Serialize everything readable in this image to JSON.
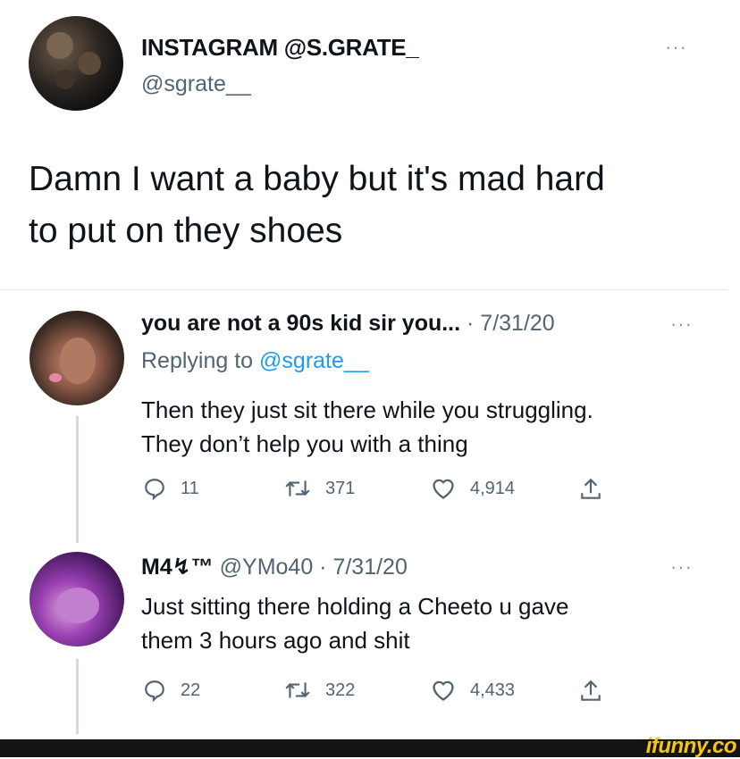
{
  "main_tweet": {
    "display_name": "INSTAGRAM @S.GRATE_",
    "handle": "@sgrate__",
    "more": "···",
    "text_line1": "Damn I want a baby but it's mad hard",
    "text_line2": "to put on they shoes"
  },
  "replies": [
    {
      "display_name": "you are not a 90s kid sir you...",
      "meta": "· 7/31/20",
      "more": "···",
      "replying_label": "Replying to",
      "replying_handle": "@sgrate__",
      "text_line1": "Then they just sit there while you struggling.",
      "text_line2": "They don’t help you with a thing",
      "replies_count": "11",
      "retweets_count": "371",
      "likes_count": "4,914"
    },
    {
      "display_name": "M4↯™",
      "meta": "@YMo40 · 7/31/20",
      "more": "···",
      "text_line1": "Just sitting there holding a Cheeto u gave",
      "text_line2": "them 3 hours ago and shit",
      "replies_count": "22",
      "retweets_count": "322",
      "likes_count": "4,433"
    }
  ],
  "watermark": "ifunny.co",
  "icons": {
    "reply": "reply-icon",
    "retweet": "retweet-icon",
    "like": "heart-icon",
    "share": "share-icon"
  }
}
